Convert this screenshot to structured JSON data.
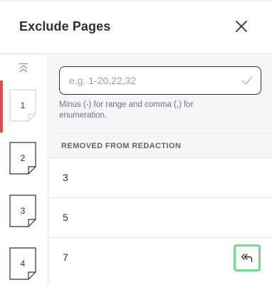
{
  "dialog": {
    "title": "Exclude Pages",
    "close_icon": "close-icon"
  },
  "sidebar": {
    "scroll_up_icon": "double-chevron-up-icon",
    "active_color": "#dd4d50",
    "pages": [
      {
        "number": "1",
        "active": true
      },
      {
        "number": "2",
        "active": false
      },
      {
        "number": "3",
        "active": false
      },
      {
        "number": "4",
        "active": false
      }
    ]
  },
  "input": {
    "value": "",
    "placeholder": "e.g. 1-20,22,32",
    "confirm_icon": "check-icon",
    "hint": "Minus (-) for range and comma (,) for enumeration."
  },
  "excluded": {
    "header": "REMOVED FROM REDACTION",
    "rows": [
      {
        "page": "3"
      },
      {
        "page": "5"
      },
      {
        "page": "7"
      }
    ],
    "undo_icon": "double-reply-icon",
    "highlight_color": "#6fdc8c"
  }
}
